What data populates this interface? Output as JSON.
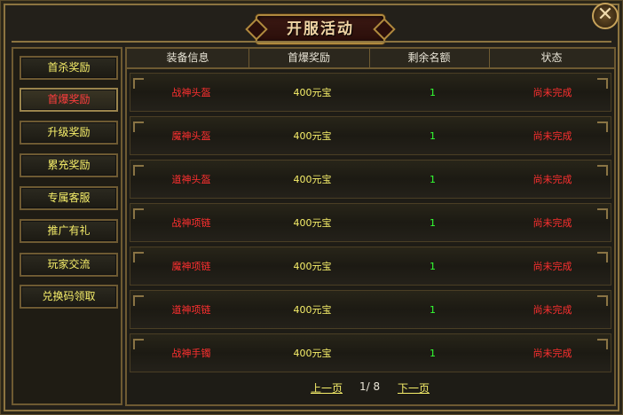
{
  "title": "开服活动",
  "close_label": "✕",
  "sidebar": {
    "items": [
      {
        "label": "首杀奖励",
        "active": false
      },
      {
        "label": "首爆奖励",
        "active": true
      },
      {
        "label": "升级奖励",
        "active": false
      },
      {
        "label": "累充奖励",
        "active": false
      },
      {
        "label": "专属客服",
        "active": false
      },
      {
        "label": "推广有礼",
        "active": false
      },
      {
        "label": "玩家交流",
        "active": false
      },
      {
        "label": "兑换码领取",
        "active": false
      }
    ]
  },
  "table": {
    "headers": [
      "装备信息",
      "首爆奖励",
      "剩余名额",
      "状态"
    ],
    "rows": [
      {
        "name": "战神头盔",
        "reward": "400元宝",
        "remaining": "1",
        "status": "尚未完成"
      },
      {
        "name": "魔神头盔",
        "reward": "400元宝",
        "remaining": "1",
        "status": "尚未完成"
      },
      {
        "name": "道神头盔",
        "reward": "400元宝",
        "remaining": "1",
        "status": "尚未完成"
      },
      {
        "name": "战神项链",
        "reward": "400元宝",
        "remaining": "1",
        "status": "尚未完成"
      },
      {
        "name": "魔神项链",
        "reward": "400元宝",
        "remaining": "1",
        "status": "尚未完成"
      },
      {
        "name": "道神项链",
        "reward": "400元宝",
        "remaining": "1",
        "status": "尚未完成"
      },
      {
        "name": "战神手镯",
        "reward": "400元宝",
        "remaining": "1",
        "status": "尚未完成"
      }
    ]
  },
  "pager": {
    "prev_label": "上一页",
    "page_text": "1/ 8",
    "next_label": "下一页"
  },
  "colors": {
    "name_red": "#ff3030",
    "reward_yellow": "#f7ef6a",
    "remaining_green": "#33ff33",
    "frame_gold": "#8c7440"
  }
}
